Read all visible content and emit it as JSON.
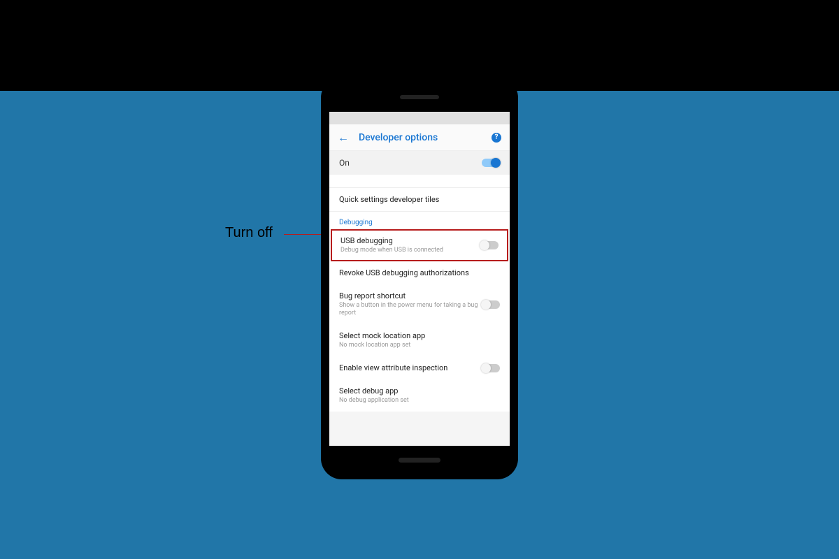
{
  "annotation": {
    "label": "Turn off"
  },
  "appbar": {
    "title": "Developer options",
    "back_glyph": "←",
    "help_glyph": "?"
  },
  "master": {
    "label": "On"
  },
  "cutoff_text": "─────────────────",
  "rows": {
    "quick_tiles": {
      "title": "Quick settings developer tiles"
    },
    "section_debugging": "Debugging",
    "usb_debugging": {
      "title": "USB debugging",
      "sub": "Debug mode when USB is connected"
    },
    "revoke": {
      "title": "Revoke USB debugging authorizations"
    },
    "bug_report": {
      "title": "Bug report shortcut",
      "sub": "Show a button in the power menu for taking a bug report"
    },
    "mock_location": {
      "title": "Select mock location app",
      "sub": "No mock location app set"
    },
    "view_attr": {
      "title": "Enable view attribute inspection"
    },
    "select_debug": {
      "title": "Select debug app",
      "sub": "No debug application set"
    }
  }
}
